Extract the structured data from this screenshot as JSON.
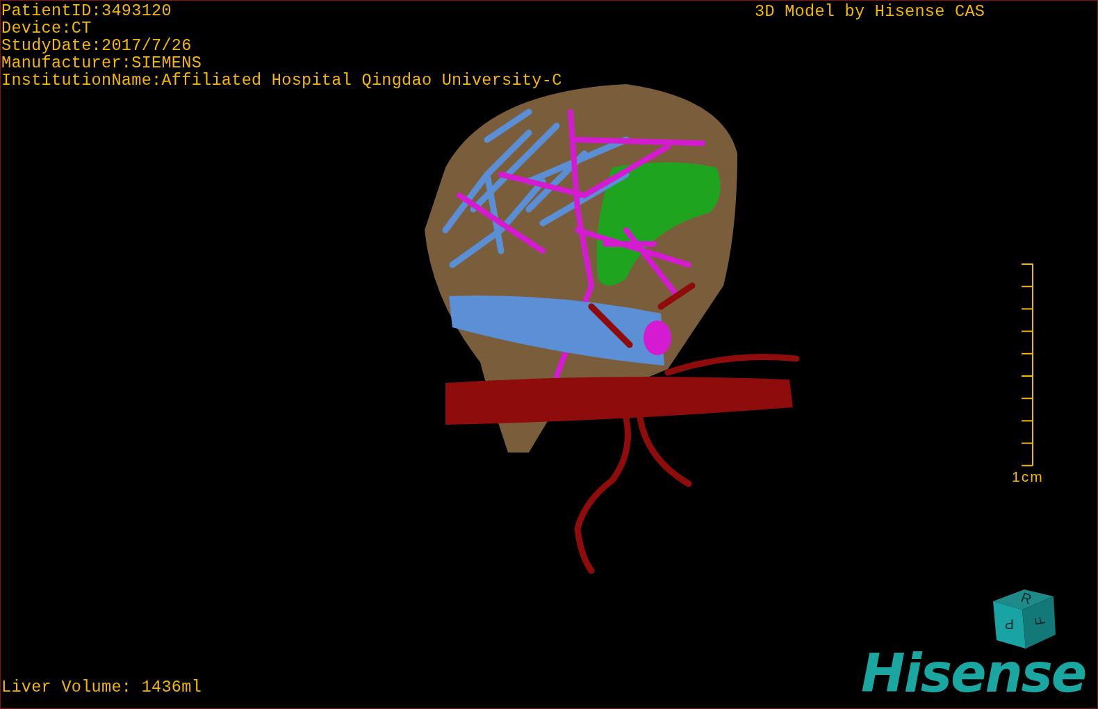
{
  "study_info": [
    "PatientID:3493120",
    "Device:CT",
    "StudyDate:2017/7/26",
    "Manufacturer:SIEMENS",
    "InstitutionName:Affiliated Hospital Qingdao University-C"
  ],
  "title": "3D Model by Hisense CAS",
  "scale_bar": {
    "label": "1cm"
  },
  "orientation_cube": {
    "top": "R",
    "front": "P",
    "side": "F"
  },
  "logo": "Hisense",
  "status": "Liver Volume: 1436ml"
}
